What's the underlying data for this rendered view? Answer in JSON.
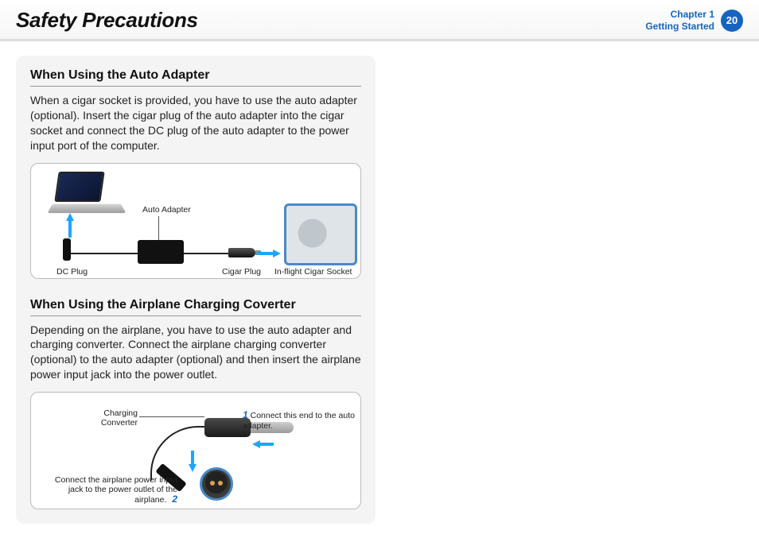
{
  "header": {
    "title": "Safety Precautions",
    "chapter_line1": "Chapter 1",
    "chapter_line2": "Getting Started",
    "page_number": "20"
  },
  "section1": {
    "heading": "When Using the Auto Adapter",
    "body": "When a cigar socket is provided, you have to use the auto adapter (optional). Insert the cigar plug of the auto adapter into the cigar socket and connect the DC plug of the auto adapter to the power input port of the computer.",
    "labels": {
      "auto_adapter": "Auto Adapter",
      "dc_plug": "DC Plug",
      "cigar_plug": "Cigar Plug",
      "inflight_socket": "In-flight Cigar Socket"
    }
  },
  "section2": {
    "heading": "When Using the Airplane Charging Coverter",
    "body": "Depending on the airplane, you have to use the auto adapter and charging converter. Connect the airplane charging converter (optional) to the auto adapter (optional) and then insert the airplane power input jack into the power outlet.",
    "labels": {
      "charging_converter": "Charging Converter",
      "step1_num": "1",
      "step1_text": "Connect this end to the auto adapter.",
      "step2_num": "2",
      "step2_text": "Connect the airplane power input jack to the power outlet of the airplane."
    }
  }
}
